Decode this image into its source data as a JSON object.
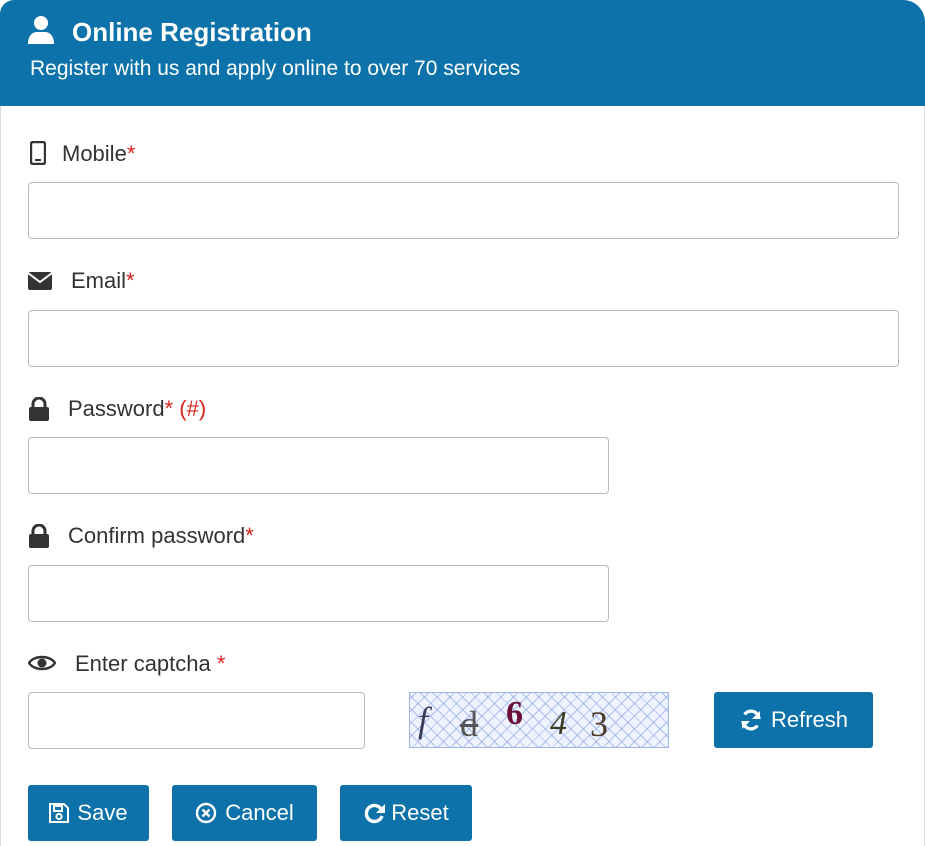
{
  "header": {
    "title": "Online Registration",
    "subtitle": "Register with us and apply online to over 70 services"
  },
  "form": {
    "mobile": {
      "label": "Mobile",
      "required_mark": "*",
      "value": ""
    },
    "email": {
      "label": "Email",
      "required_mark": "*",
      "value": ""
    },
    "password": {
      "label": "Password",
      "required_mark": "*",
      "note": "(#)",
      "value": ""
    },
    "confirm_password": {
      "label": "Confirm password",
      "required_mark": "*",
      "value": ""
    },
    "captcha": {
      "label": "Enter captcha ",
      "required_mark": "*",
      "value": "",
      "image_chars": [
        "f",
        "d",
        "6",
        "4",
        "3"
      ]
    }
  },
  "buttons": {
    "refresh": "Refresh",
    "save": "Save",
    "cancel": "Cancel",
    "reset": "Reset"
  },
  "icons": {
    "header": "user-icon",
    "mobile": "mobile-phone-icon",
    "email": "envelope-icon",
    "password": "lock-icon",
    "confirm_password": "lock-icon",
    "captcha": "eye-icon",
    "refresh": "refresh-icon",
    "save": "floppy-disk-icon",
    "cancel": "circle-x-icon",
    "reset": "redo-icon"
  },
  "colors": {
    "primary": "#0c72a9",
    "required": "#d9231d",
    "text": "#333333",
    "input_border": "#b9b9b9"
  }
}
